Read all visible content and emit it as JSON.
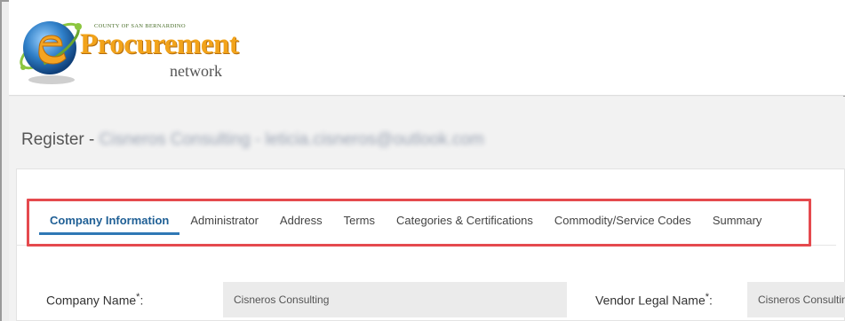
{
  "header": {
    "logo": {
      "county": "COUNTY OF SAN BERNARDINO",
      "brand": "Procurement",
      "sub": "network",
      "colors": {
        "brand": "#f2a31a",
        "globe_blue": "#1f6fb2",
        "globe_green": "#7cb342"
      }
    }
  },
  "page": {
    "title_prefix": "Register - ",
    "title_detail": "Cisneros Consulting - leticia.cisneros@outlook.com"
  },
  "tabs": [
    {
      "label": "Company Information",
      "active": true
    },
    {
      "label": "Administrator",
      "active": false
    },
    {
      "label": "Address",
      "active": false
    },
    {
      "label": "Terms",
      "active": false
    },
    {
      "label": "Categories & Certifications",
      "active": false
    },
    {
      "label": "Commodity/Service Codes",
      "active": false
    },
    {
      "label": "Summary",
      "active": false
    }
  ],
  "form": {
    "company_name": {
      "label": "Company Name",
      "required": "*",
      "suffix": ":",
      "value": "Cisneros Consulting"
    },
    "vendor_legal_name": {
      "label": "Vendor Legal Name",
      "required": "*",
      "suffix": ":",
      "value": "Cisneros Consulting"
    }
  },
  "colors": {
    "highlight_border": "#e54a4e",
    "active_tab": "#1f5f95",
    "active_underline": "#2f78b5"
  }
}
